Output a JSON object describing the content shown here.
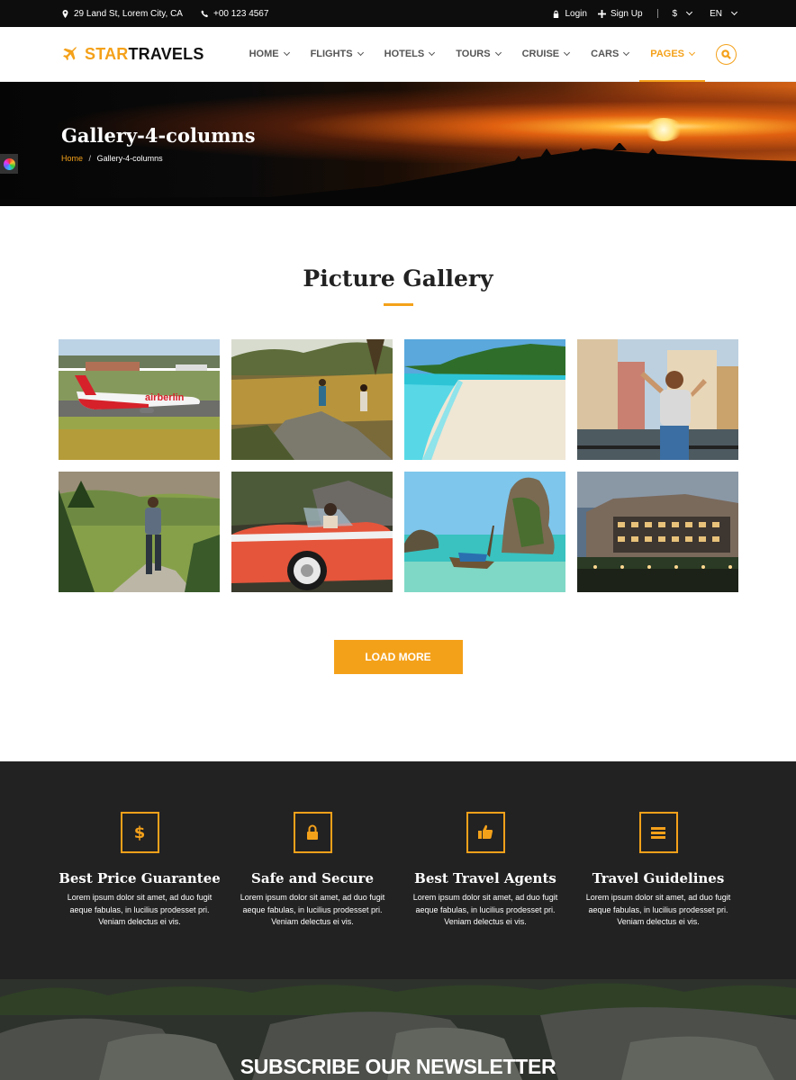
{
  "topbar": {
    "address": "29 Land St, Lorem City, CA",
    "phone": "+00 123 4567",
    "login": "Login",
    "signup": "Sign Up",
    "currency": "$",
    "language": "EN"
  },
  "brand": {
    "part1": "STAR",
    "part2": "TRAVELS"
  },
  "nav": {
    "items": [
      {
        "label": "HOME"
      },
      {
        "label": "FLIGHTS"
      },
      {
        "label": "HOTELS"
      },
      {
        "label": "TOURS"
      },
      {
        "label": "CRUISE"
      },
      {
        "label": "CARS"
      },
      {
        "label": "PAGES"
      }
    ],
    "active": "PAGES"
  },
  "hero": {
    "title": "Gallery-4-columns",
    "breadcrumb_home": "Home",
    "breadcrumb_sep": "/",
    "breadcrumb_current": "Gallery-4-columns"
  },
  "gallery": {
    "title": "Picture Gallery",
    "load_more": "LOAD MORE",
    "photo_livery": "airberlin"
  },
  "features": [
    {
      "title": "Best Price Guarantee",
      "icon": "dollar-icon",
      "text": "Lorem ipsum dolor sit amet, ad duo fugit aeque fabulas, in lucilius prodesset pri. Veniam delectus ei vis."
    },
    {
      "title": "Safe and Secure",
      "icon": "lock-icon",
      "text": "Lorem ipsum dolor sit amet, ad duo fugit aeque fabulas, in lucilius prodesset pri. Veniam delectus ei vis."
    },
    {
      "title": "Best Travel Agents",
      "icon": "thumbs-up-icon",
      "text": "Lorem ipsum dolor sit amet, ad duo fugit aeque fabulas, in lucilius prodesset pri. Veniam delectus ei vis."
    },
    {
      "title": "Travel Guidelines",
      "icon": "list-icon",
      "text": "Lorem ipsum dolor sit amet, ad duo fugit aeque fabulas, in lucilius prodesset pri. Veniam delectus ei vis."
    }
  ],
  "newsletter": {
    "title": "SUBSCRIBE OUR NEWSLETTER"
  },
  "colors": {
    "accent": "#f4a11a",
    "dark": "#222222",
    "topbar": "#0d0d0d"
  }
}
